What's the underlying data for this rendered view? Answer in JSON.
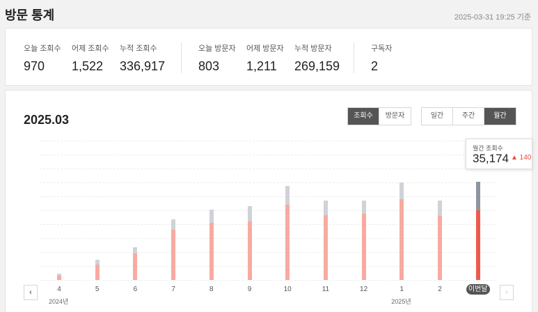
{
  "header": {
    "title": "방문 통계",
    "timestamp": "2025-03-31 19:25 기준"
  },
  "stats": {
    "views_today_label": "오늘 조회수",
    "views_today": "970",
    "views_yesterday_label": "어제 조회수",
    "views_yesterday": "1,522",
    "views_total_label": "누적 조회수",
    "views_total": "336,917",
    "visitors_today_label": "오늘 방문자",
    "visitors_today": "803",
    "visitors_yesterday_label": "어제 방문자",
    "visitors_yesterday": "1,211",
    "visitors_total_label": "누적 방문자",
    "visitors_total": "269,159",
    "subscribers_label": "구독자",
    "subscribers": "2"
  },
  "chart_panel": {
    "period_title": "2025.03",
    "metric_tabs": [
      {
        "label": "조회수",
        "active": true
      },
      {
        "label": "방문자",
        "active": false
      }
    ],
    "range_tabs": [
      {
        "label": "일간",
        "active": false
      },
      {
        "label": "주간",
        "active": false
      },
      {
        "label": "월간",
        "active": true
      }
    ],
    "prev_icon": "chevron-left-icon",
    "next_icon": "chevron-right-icon",
    "tooltip": {
      "label": "월간 조회수",
      "value": "35,174",
      "delta": "▲ 140"
    },
    "year_labels": [
      {
        "label": "2024년",
        "category_index": 0
      },
      {
        "label": "2025년",
        "category_index": 9
      }
    ]
  },
  "chart_data": {
    "type": "bar",
    "stacked": true,
    "categories": [
      "4",
      "5",
      "6",
      "7",
      "8",
      "9",
      "10",
      "11",
      "12",
      "1",
      "2",
      "이번달"
    ],
    "series": [
      {
        "values": [
          1500,
          5500,
          9400,
          18100,
          20500,
          21000,
          26900,
          23200,
          23700,
          29000,
          23000,
          24900
        ],
        "color": "#f8aaa0",
        "current_color": "#ee5a4c"
      },
      {
        "values": [
          700,
          1800,
          2300,
          3700,
          4700,
          5500,
          6800,
          5400,
          4700,
          6100,
          5500,
          10274
        ],
        "color": "#cfd2d6",
        "current_color": "#8d959e"
      }
    ],
    "ylim": [
      0,
      50000
    ],
    "grid": true,
    "current_index": 11
  }
}
